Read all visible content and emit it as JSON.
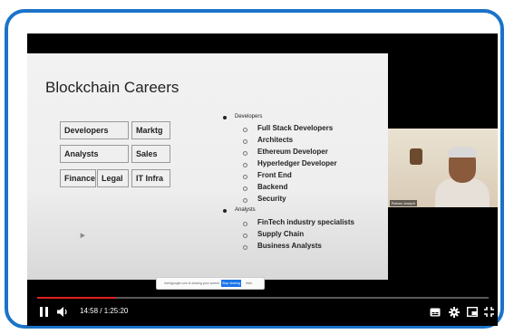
{
  "slide": {
    "title": "Blockchain Careers",
    "boxes": {
      "developers": "Developers",
      "marktg": "Marktg",
      "analysts": "Analysts",
      "sales": "Sales",
      "finance": "Finance",
      "legal": "Legal",
      "it_infra": "IT Infra"
    },
    "bullets": {
      "group1": "Developers",
      "group1_items": [
        "Full Stack Developers",
        "Architects",
        "Ethereum Developer",
        "Hyperledger Developer",
        "Front End",
        "Backend",
        "Security"
      ],
      "group2": "Analysts",
      "group2_items": [
        "FinTech industry specialists",
        "Supply Chain",
        "Business Analysts"
      ]
    }
  },
  "share_bar": {
    "message": "meetgoogle.com is sharing your screen.",
    "stop_label": "Stop sharing",
    "hide_label": "Hide"
  },
  "camera": {
    "name_tag": "Rohan Joseph"
  },
  "player": {
    "time_display": "14:58 / 1:25:20",
    "progress_fraction": 0.175,
    "icons": {
      "pause": "pause-icon",
      "volume": "volume-icon",
      "captions": "captions-icon",
      "settings": "gear-icon",
      "miniplayer": "miniplayer-icon",
      "exit_fullscreen": "exit-fullscreen-icon"
    },
    "accent": "#e02020"
  },
  "frame_color": "#1a73c8"
}
